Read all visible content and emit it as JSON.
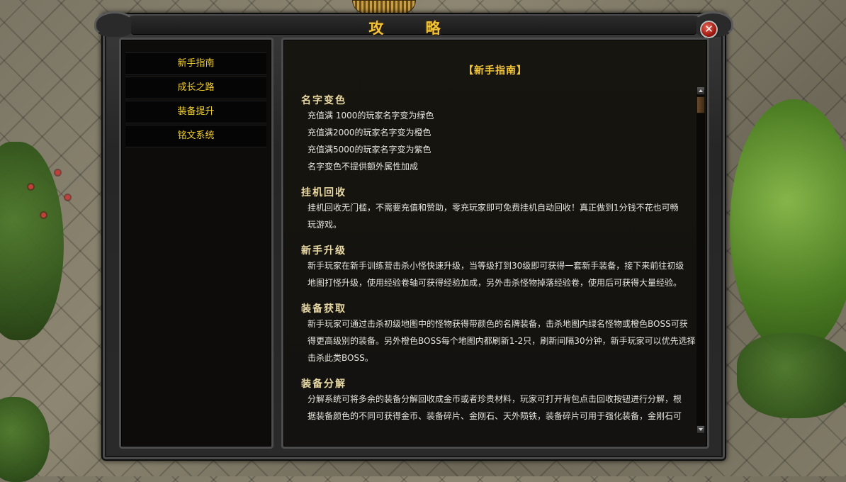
{
  "window": {
    "title": "攻 略",
    "close_label": "✕"
  },
  "nav": {
    "items": [
      {
        "label": "新手指南"
      },
      {
        "label": "成长之路"
      },
      {
        "label": "装备提升"
      },
      {
        "label": "铭文系统"
      }
    ]
  },
  "content": {
    "title": "【新手指南】",
    "sections": [
      {
        "heading": "名字变色",
        "lines": [
          "充值满 1000的玩家名字变为绿色",
          "充值满2000的玩家名字变为橙色",
          "充值满5000的玩家名字变为紫色",
          "名字变色不提供额外属性加成"
        ]
      },
      {
        "heading": "挂机回收",
        "lines": [
          "挂机回收无门槛，不需要充值和赞助，零充玩家即可免费挂机自动回收！真正做到1分钱不花也可畅",
          "玩游戏。"
        ]
      },
      {
        "heading": "新手升级",
        "lines": [
          "新手玩家在新手训练营击杀小怪快速升级，当等级打到30级即可获得一套新手装备，接下来前往初级",
          "地图打怪升级，使用经验卷轴可获得经验加成，另外击杀怪物掉落经验卷，使用后可获得大量经验。"
        ]
      },
      {
        "heading": "装备获取",
        "lines": [
          "新手玩家可通过击杀初级地图中的怪物获得带颜色的名牌装备，击杀地图内绿名怪物或橙色BOSS可获",
          "得更高级别的装备。另外橙色BOSS每个地图内都刷新1-2只，刷新间隔30分钟，新手玩家可以优先选择",
          "击杀此类BOSS。"
        ]
      },
      {
        "heading": "装备分解",
        "lines": [
          "分解系统可将多余的装备分解回收成金币或者珍贵材料，玩家可打开背包点击回收按钮进行分解，根",
          "据装备颜色的不同可获得金币、装备碎片、金刚石、天外陨铁，装备碎片可用于强化装备，金刚石可"
        ]
      }
    ]
  },
  "colors": {
    "accent": "#f2c437",
    "nav_text": "#f2d030",
    "heading": "#e9d9a5",
    "body_text": "#e8e6df"
  }
}
